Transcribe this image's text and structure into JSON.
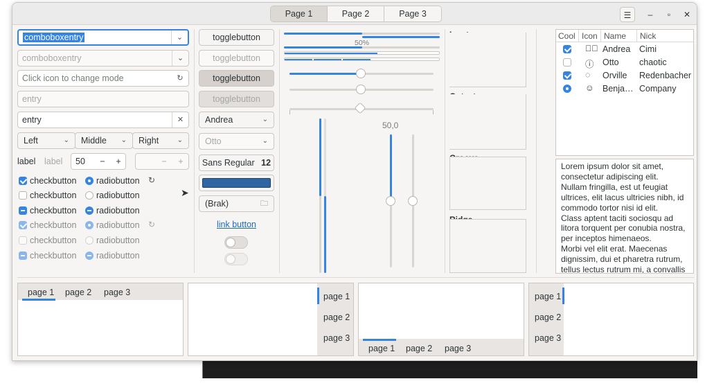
{
  "titlebar": {
    "tabs": [
      "Page 1",
      "Page 2",
      "Page 3"
    ],
    "menu_icon": "hamburger-icon",
    "minimize_icon": "minimize-icon",
    "maximize_icon": "maximize-icon",
    "close_icon": "close-icon"
  },
  "col1": {
    "combo_entry_value": "comboboxentry",
    "combo_entry_disabled_value": "comboboxentry",
    "icon_entry_placeholder": "Click icon to change mode",
    "entry_placeholder_disabled": "entry",
    "entry_value": "entry",
    "segments": [
      "Left",
      "Middle",
      "Right"
    ],
    "label1": "label",
    "label2": "label",
    "spin_value": "50",
    "checks": [
      "checkbutton",
      "checkbutton",
      "checkbutton",
      "checkbutton",
      "checkbutton",
      "checkbutton"
    ],
    "radios": [
      "radiobutton",
      "radiobutton",
      "radiobutton",
      "radiobutton",
      "radiobutton",
      "radiobutton"
    ]
  },
  "col2": {
    "toggles": [
      "togglebutton",
      "togglebutton",
      "togglebutton",
      "togglebutton"
    ],
    "combo1": "Andrea",
    "combo2": "Otto",
    "font_name": "Sans Regular",
    "font_size": "12",
    "color_value": "#2f65a3",
    "file_button": "(Brak)",
    "link": "link button",
    "switch1_on": false,
    "switch2_on": false
  },
  "col3": {
    "progress_label": "50%",
    "scale_value_label": "50,0"
  },
  "frames": {
    "inset": "Inset",
    "outset": "Outset",
    "groove": "Groove",
    "ridge": "Ridge"
  },
  "tree": {
    "headers": [
      "Cool",
      "Icon",
      "Name",
      "Nick"
    ],
    "rows": [
      {
        "cool": "checked",
        "icon": "check-circle-icon",
        "name": "Andrea",
        "nick": "Cimi"
      },
      {
        "cool": "unchecked",
        "icon": "info-circle-icon",
        "name": "Otto",
        "nick": "chaotic"
      },
      {
        "cool": "checked",
        "icon": "loading-icon",
        "name": "Orville",
        "nick": "Redenbacher"
      },
      {
        "cool": "radio",
        "icon": "face-icon",
        "name": "Benja…",
        "nick": "Company"
      }
    ]
  },
  "textview": {
    "lines": [
      "Lorem ipsum dolor sit amet,",
      "consectetur adipiscing elit.",
      "Nullam fringilla, est ut feugiat",
      "ultrices, elit lacus ultricies nibh, id",
      "commodo tortor nisi id elit.",
      "Class aptent taciti sociosqu ad",
      "litora torquent per conubia nostra,",
      "per inceptos himenaeos.",
      "Morbi vel elit erat. Maecenas",
      "dignissim, dui et pharetra rutrum,",
      "tellus lectus rutrum mi, a convallis"
    ]
  },
  "notebooks": {
    "nb1_tabs": [
      "page 1",
      "page 2",
      "page 3"
    ],
    "nb2_tabs": [
      "page 1",
      "page 2",
      "page 3"
    ],
    "nb3_tabs": [
      "page 1",
      "page 2",
      "page 3"
    ],
    "nb4_tabs": [
      "page 1",
      "page 2",
      "page 3"
    ]
  },
  "colors": {
    "accent": "#3584e4",
    "window_bg": "#f6f5f4",
    "color_swatch": "#2f65a3"
  }
}
